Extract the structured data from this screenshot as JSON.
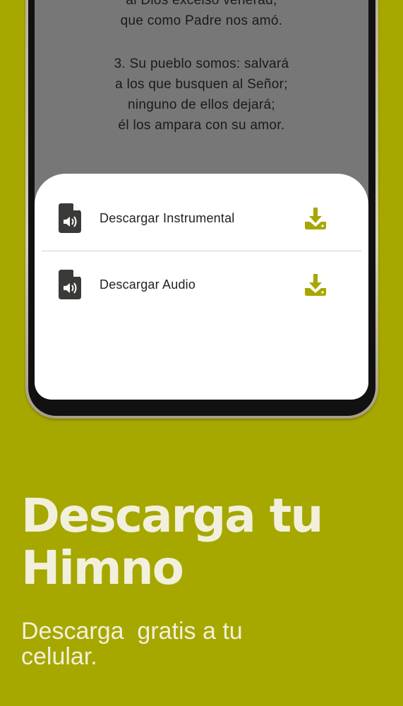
{
  "lyrics": {
    "lines": [
      "al Dios excelso venerad,",
      "que como Padre nos amó.",
      "3. Su pueblo somos: salvará",
      "a los que busquen al Señor;",
      "ninguno de ellos dejará;",
      "él los ampara con su amor."
    ]
  },
  "download_sheet": {
    "items": [
      {
        "label": "Descargar Instrumental",
        "icon": "audio-file-icon",
        "action_icon": "download-icon"
      },
      {
        "label": "Descargar Audio",
        "icon": "audio-file-icon",
        "action_icon": "download-icon"
      }
    ]
  },
  "promo": {
    "headline_line1": "Descarga tu",
    "headline_line2": "Himno",
    "subtitle_line1": "Descarga  gratis a tu",
    "subtitle_line2": "celular."
  },
  "colors": {
    "background": "#a6a800",
    "accent": "#a6a800",
    "promo_text": "#f2f0dc",
    "screen_dim": "#777777"
  }
}
